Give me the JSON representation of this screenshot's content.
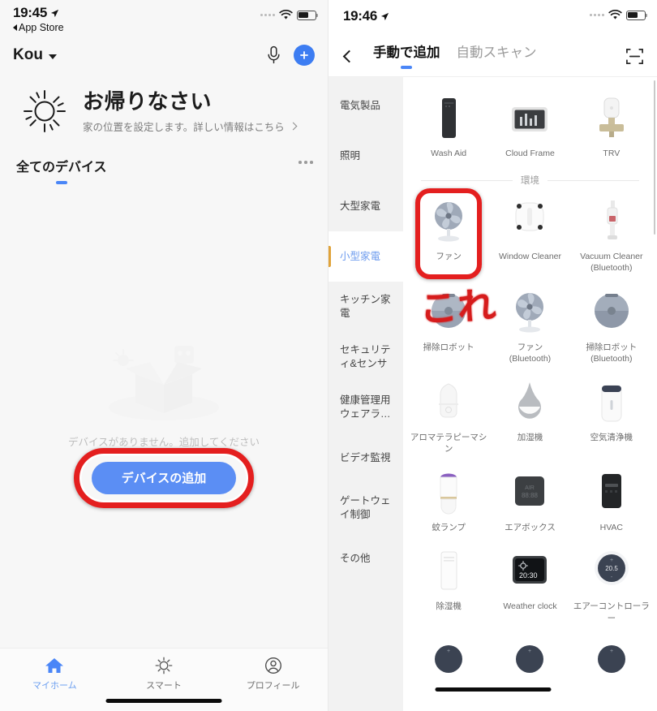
{
  "left_screen": {
    "status_bar": {
      "time": "19:45",
      "back_label": "App Store",
      "location_icon": "location-arrow-icon",
      "wifi_icon": "wifi-icon",
      "battery_icon": "battery-icon"
    },
    "top_bar": {
      "home_name": "Kou",
      "chevron_icon": "chevron-down-icon",
      "mic_icon": "microphone-icon",
      "add_icon": "plus-icon"
    },
    "weather_card": {
      "sun_icon": "sun-icon",
      "greeting": "お帰りなさい",
      "subtitle": "家の位置を設定します。詳しい情報はこちら",
      "chevron_icon": "chevron-right-icon"
    },
    "device_tab": {
      "label": "全てのデバイス",
      "more_icon": "more-horizontal-icon"
    },
    "empty_state": {
      "box_icon": "empty-box-illustration",
      "message": "デバイスがありません。追加してください",
      "add_button": "デバイスの追加"
    },
    "tab_bar": {
      "items": [
        {
          "label": "マイホーム",
          "icon": "home-icon",
          "active": true
        },
        {
          "label": "スマート",
          "icon": "sun-icon",
          "active": false
        },
        {
          "label": "プロフィール",
          "icon": "person-circle-icon",
          "active": false
        }
      ]
    }
  },
  "right_screen": {
    "status_bar": {
      "time": "19:46",
      "location_icon": "location-arrow-icon",
      "wifi_icon": "wifi-icon",
      "battery_icon": "battery-icon"
    },
    "nav_bar": {
      "back_icon": "chevron-left-icon",
      "scan_icon": "qr-scan-icon",
      "tabs": [
        {
          "label": "手動で追加",
          "active": true
        },
        {
          "label": "自動スキャン",
          "active": false
        }
      ]
    },
    "categories": [
      {
        "label": "電気製品",
        "active": false
      },
      {
        "label": "照明",
        "active": false
      },
      {
        "label": "大型家電",
        "active": false
      },
      {
        "label": "小型家電",
        "active": true
      },
      {
        "label": "キッチン家電",
        "active": false
      },
      {
        "label": "セキュリティ&センサ",
        "active": false
      },
      {
        "label": "健康管理用ウェアラ…",
        "active": false
      },
      {
        "label": "ビデオ監視",
        "active": false
      },
      {
        "label": "ゲートウェイ制御",
        "active": false
      },
      {
        "label": "その他",
        "active": false
      }
    ],
    "section_label": "環境",
    "annotation": "これ",
    "device_rows": [
      {
        "cells": [
          {
            "name": "Wash Aid",
            "icon": "wash-aid-icon",
            "highlighted": false
          },
          {
            "name": "Cloud Frame",
            "icon": "cloud-frame-icon",
            "highlighted": false
          },
          {
            "name": "TRV",
            "icon": "trv-valve-icon",
            "highlighted": false
          }
        ]
      },
      {
        "cells": [
          {
            "name": "ファン",
            "icon": "fan-icon",
            "highlighted": true
          },
          {
            "name": "Window Cleaner",
            "icon": "window-cleaner-icon",
            "highlighted": false
          },
          {
            "name": "Vacuum Cleaner\n(Bluetooth)",
            "icon": "vacuum-cleaner-icon",
            "highlighted": false
          }
        ]
      },
      {
        "cells": [
          {
            "name": "掃除ロボット",
            "icon": "robot-vacuum-icon",
            "highlighted": false
          },
          {
            "name": "ファン\n(Bluetooth)",
            "icon": "fan-bluetooth-icon",
            "highlighted": false
          },
          {
            "name": "掃除ロボット\n(Bluetooth)",
            "icon": "robot-vacuum-bluetooth-icon",
            "highlighted": false
          }
        ]
      },
      {
        "cells": [
          {
            "name": "アロマテラピーマシン",
            "icon": "aroma-diffuser-icon",
            "highlighted": false
          },
          {
            "name": "加湿機",
            "icon": "humidifier-icon",
            "highlighted": false
          },
          {
            "name": "空気清浄機",
            "icon": "air-purifier-icon",
            "highlighted": false
          }
        ]
      },
      {
        "cells": [
          {
            "name": "蚊ランプ",
            "icon": "mosquito-lamp-icon",
            "highlighted": false
          },
          {
            "name": "エアボックス",
            "icon": "air-box-icon",
            "highlighted": false
          },
          {
            "name": "HVAC",
            "icon": "hvac-icon",
            "highlighted": false
          }
        ]
      },
      {
        "cells": [
          {
            "name": "除湿機",
            "icon": "dehumidifier-icon",
            "highlighted": false
          },
          {
            "name": "Weather clock",
            "icon": "weather-clock-icon",
            "highlighted": false
          },
          {
            "name": "エアーコントローラー",
            "icon": "air-controller-icon",
            "highlighted": false
          }
        ]
      }
    ],
    "device_icon_labels": {
      "air_box_text": "AIR",
      "air_box_value": "88:88",
      "weather_clock_time": "20:30",
      "air_controller_temp": "20.5"
    }
  },
  "colors": {
    "accent_blue": "#3d7df2",
    "button_blue": "#5b8ef4",
    "annotation_red": "#d61c1c",
    "highlight_ring": "#e41f1f",
    "category_marker": "#e0a33a"
  }
}
